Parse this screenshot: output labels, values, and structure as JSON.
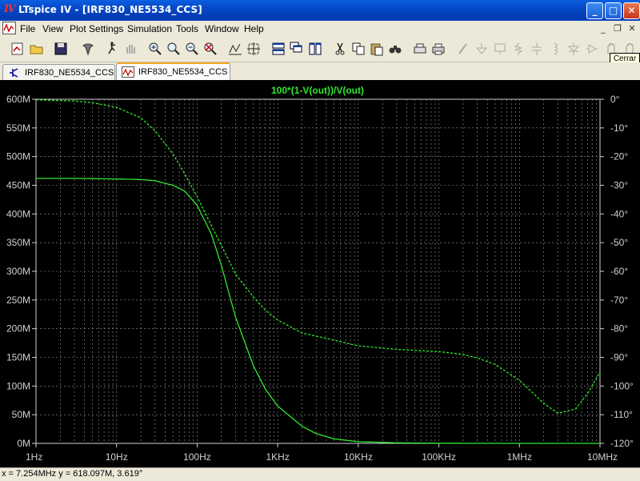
{
  "window": {
    "title": "LTspice IV - [IRF830_NE5534_CCS]",
    "controls": {
      "minimize": "_",
      "maximize": "□",
      "close": "✕"
    }
  },
  "menu": [
    "File",
    "View",
    "Plot Settings",
    "Simulation",
    "Tools",
    "Window",
    "Help"
  ],
  "toolbar": {
    "tooltip": "Cerrar",
    "icons": [
      "new-schematic-icon",
      "open-icon",
      "save-icon",
      "control-panel-icon",
      "run-icon",
      "halt-icon",
      "zoom-in-icon",
      "zoom-pan-icon",
      "zoom-out-icon",
      "zoom-fit-icon",
      "autorange-icon",
      "zoom-extent-icon",
      "tile-horizontal-icon",
      "cascade-icon",
      "tile-vertical-icon",
      "cut-icon",
      "copy-icon",
      "paste-icon",
      "find-icon",
      "print-setup-icon",
      "print-icon",
      "wire-icon",
      "ground-icon",
      "label-icon",
      "resistor-icon",
      "capacitor-icon",
      "inductor-icon",
      "diode-icon",
      "component-icon",
      "move-icon",
      "drag-icon"
    ]
  },
  "tabs": [
    {
      "label": "IRF830_NE5534_CCS",
      "type": "schematic",
      "active": false
    },
    {
      "label": "IRF830_NE5534_CCS",
      "type": "waveform",
      "active": true
    }
  ],
  "status": "x = 7.254MHz    y = 618.097M, 3.619°",
  "colors": {
    "trace": "#30e830",
    "background": "#000000",
    "grid": "#9a9a9a"
  },
  "chart_data": {
    "type": "line",
    "title": "100*(1-V(out))/V(out)",
    "x_scale": "log",
    "x_ticks": [
      "1Hz",
      "10Hz",
      "100Hz",
      "1KHz",
      "10KHz",
      "100KHz",
      "1MHz",
      "10MHz"
    ],
    "x_range": [
      1,
      10000000
    ],
    "y_left_ticks": [
      "0M",
      "50M",
      "100M",
      "150M",
      "200M",
      "250M",
      "300M",
      "350M",
      "400M",
      "450M",
      "500M",
      "550M",
      "600M"
    ],
    "y_left_range": [
      0,
      600
    ],
    "y_right_ticks": [
      "0°",
      "-10°",
      "-20°",
      "-30°",
      "-40°",
      "-50°",
      "-60°",
      "-70°",
      "-80°",
      "-90°",
      "-100°",
      "-110°",
      "-120°"
    ],
    "y_right_range": [
      -120,
      0
    ],
    "grid": true,
    "series": [
      {
        "name": "magnitude",
        "style": "solid",
        "x": [
          1,
          3,
          10,
          20,
          30,
          50,
          70,
          100,
          150,
          200,
          300,
          500,
          700,
          1000,
          2000,
          3000,
          5000,
          10000,
          30000,
          100000,
          1000000,
          10000000
        ],
        "y": [
          462,
          462,
          461,
          460,
          458,
          450,
          440,
          415,
          365,
          310,
          220,
          135,
          95,
          65,
          30,
          17,
          8,
          3,
          1,
          0.3,
          0,
          0
        ]
      },
      {
        "name": "phase",
        "style": "dashed",
        "x": [
          1,
          3,
          5,
          10,
          20,
          30,
          50,
          70,
          100,
          150,
          200,
          300,
          500,
          700,
          1000,
          2000,
          5000,
          10000,
          30000,
          100000,
          200000,
          300000,
          500000,
          1000000,
          2000000,
          3000000,
          5000000,
          7254000,
          10000000
        ],
        "y": [
          -0.2,
          -0.6,
          -1.2,
          -2.8,
          -6.5,
          -11,
          -19,
          -26,
          -34,
          -44,
          -51,
          -61,
          -69,
          -73.5,
          -77,
          -81.5,
          -84,
          -86,
          -87.2,
          -88,
          -89,
          -90.2,
          -92.5,
          -98,
          -106,
          -109.5,
          -108,
          -102,
          -95
        ]
      }
    ]
  }
}
